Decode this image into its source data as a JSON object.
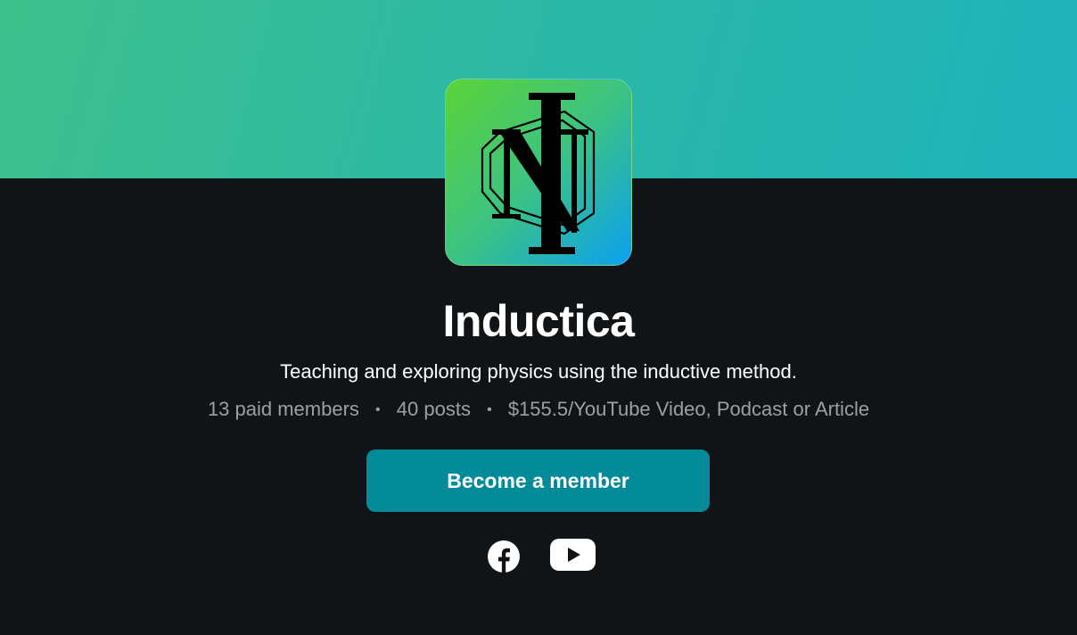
{
  "publication": {
    "name": "Inductica",
    "tagline": "Teaching and exploring physics using the inductive method.",
    "logo_icon": "inductica-logo-icon"
  },
  "stats": {
    "paid_members": "13 paid members",
    "posts": "40 posts",
    "price": "$155.5/YouTube Video, Podcast or Article",
    "separator": "•"
  },
  "cta": {
    "label": "Become a member"
  },
  "social": {
    "facebook_icon": "facebook-icon",
    "youtube_icon": "youtube-icon"
  },
  "colors": {
    "background": "#101417",
    "banner_start": "#3ec08c",
    "banner_end": "#1fb2bb",
    "button": "#048b99",
    "muted_text": "#9aa1a6"
  }
}
